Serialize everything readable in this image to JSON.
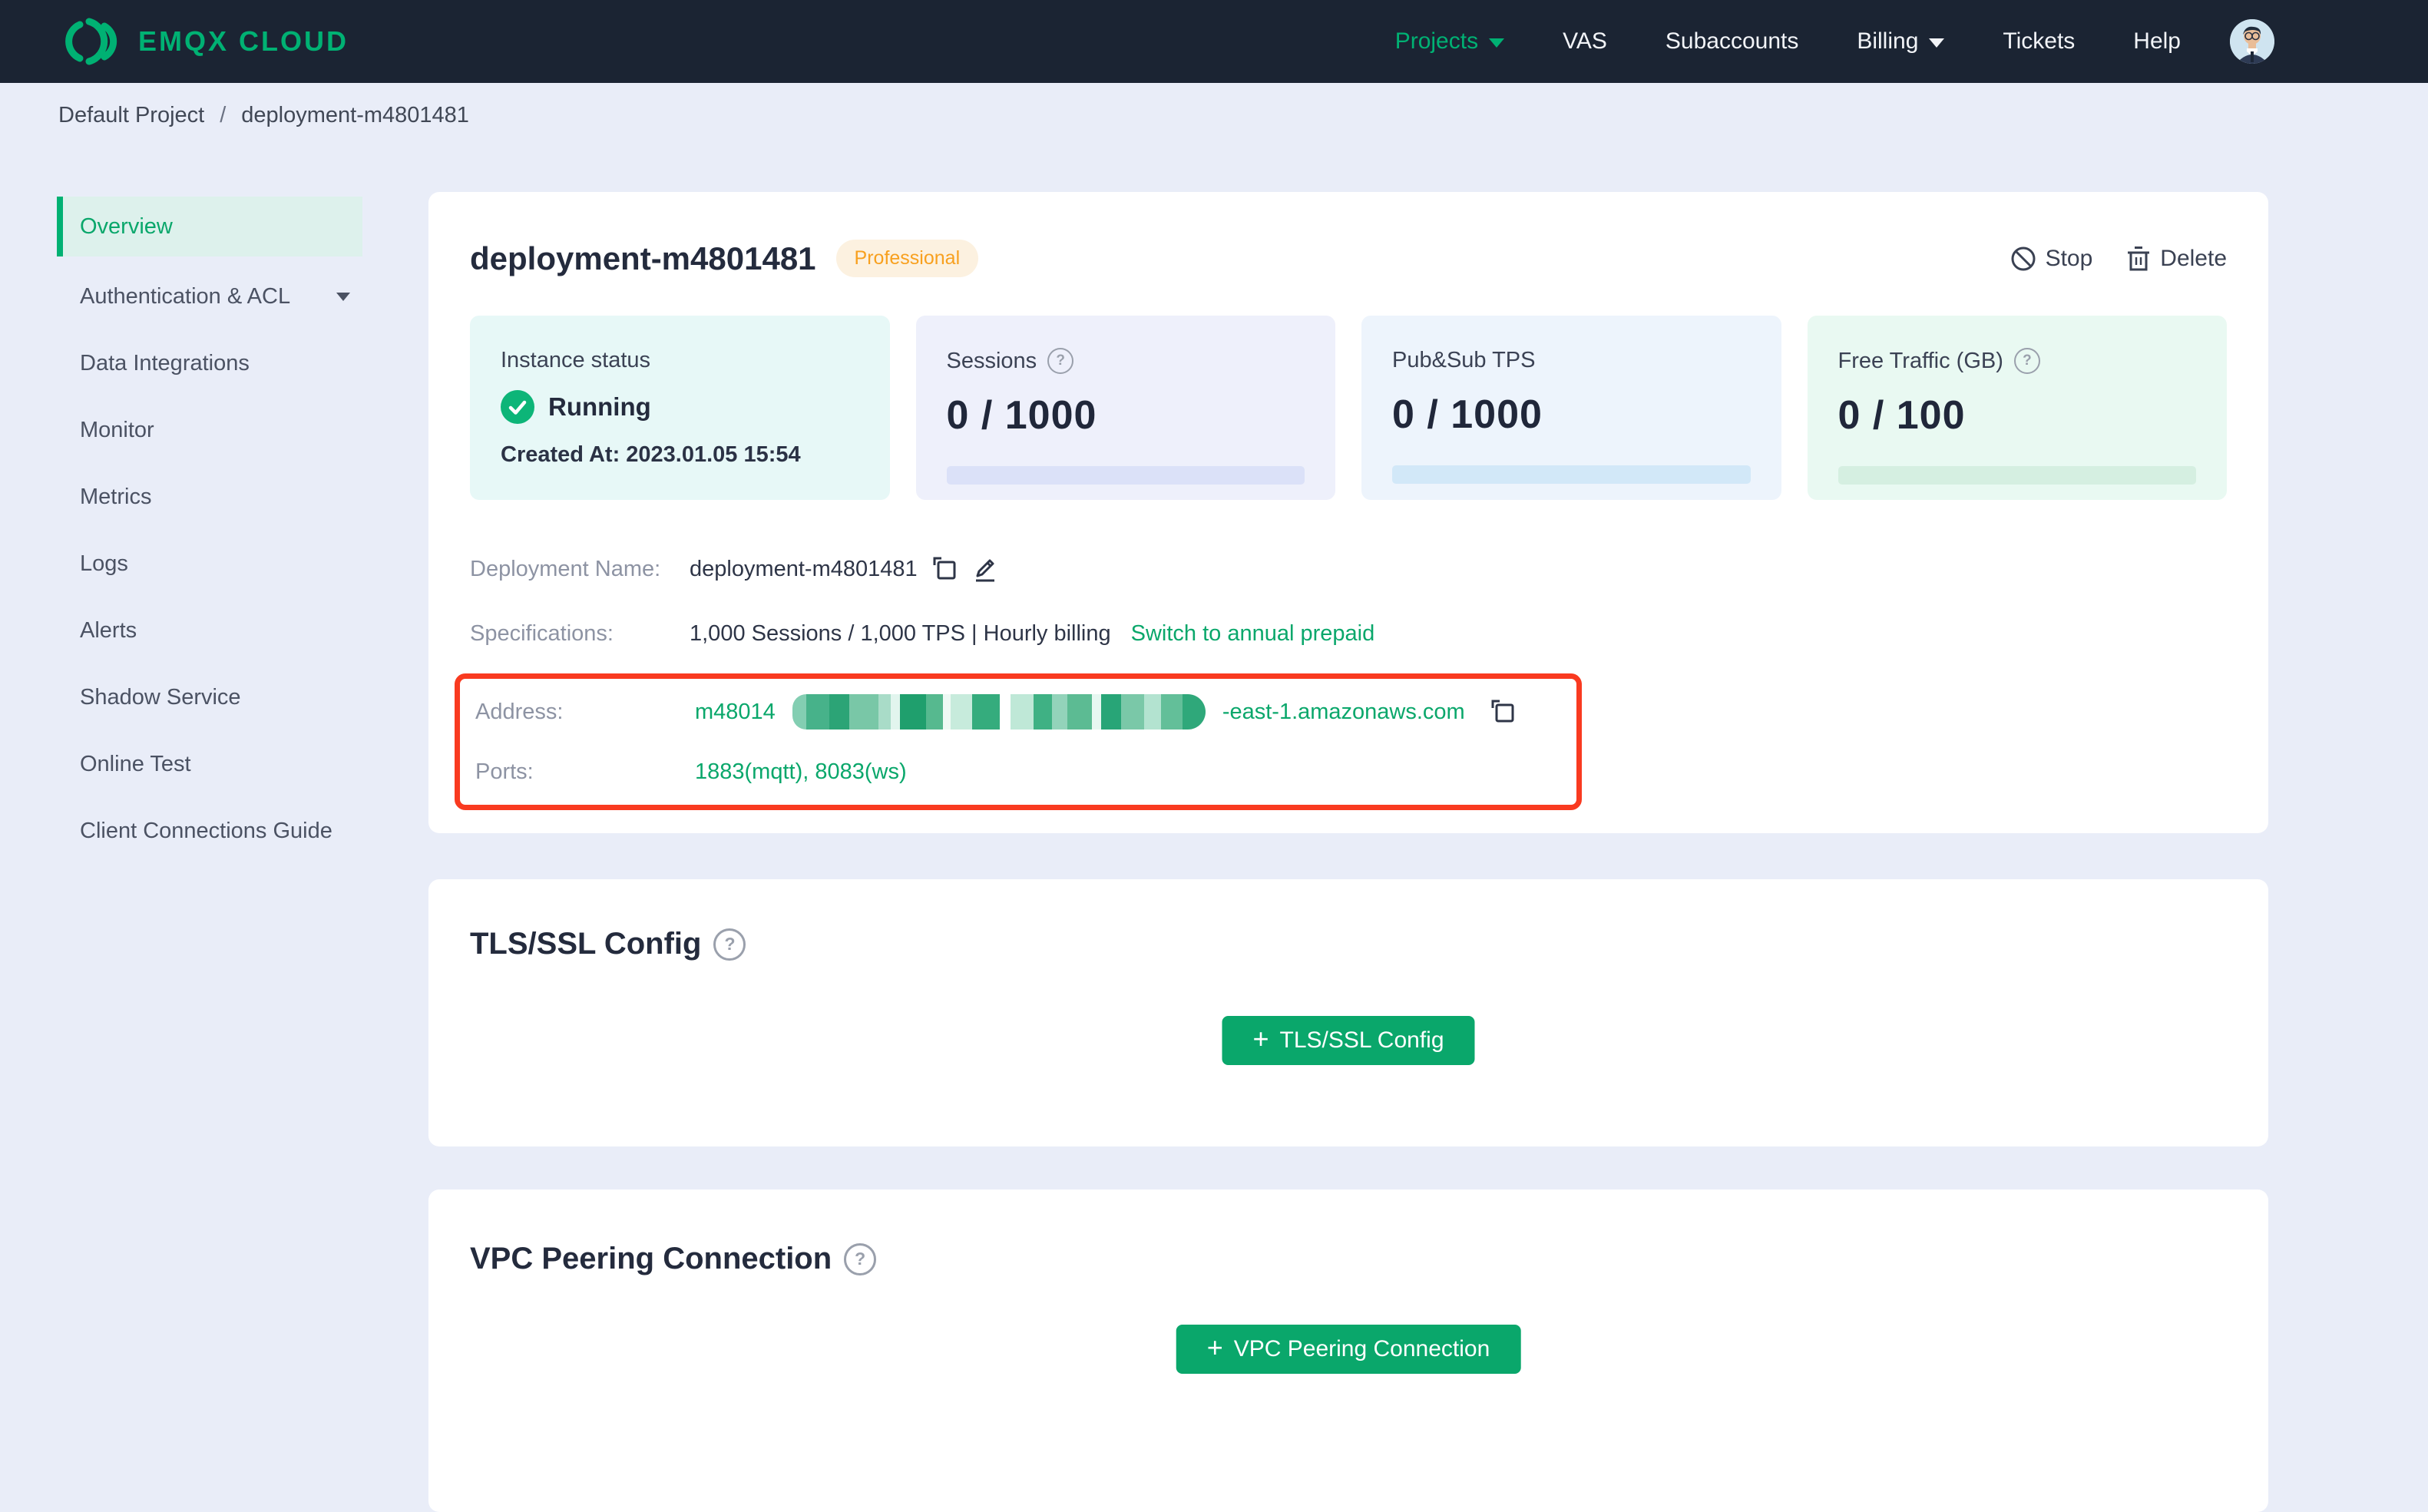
{
  "navbar": {
    "logo_text": "EMQX CLOUD",
    "items": [
      {
        "label": "Projects",
        "active": true,
        "has_dropdown": true
      },
      {
        "label": "VAS"
      },
      {
        "label": "Subaccounts"
      },
      {
        "label": "Billing",
        "has_dropdown": true
      },
      {
        "label": "Tickets"
      },
      {
        "label": "Help"
      }
    ]
  },
  "breadcrumb": {
    "project": "Default Project",
    "separator": "/",
    "current": "deployment-m4801481"
  },
  "sidebar": {
    "items": [
      {
        "label": "Overview",
        "active": true
      },
      {
        "label": "Authentication & ACL",
        "has_dropdown": true
      },
      {
        "label": "Data Integrations"
      },
      {
        "label": "Monitor"
      },
      {
        "label": "Metrics"
      },
      {
        "label": "Logs"
      },
      {
        "label": "Alerts"
      },
      {
        "label": "Shadow Service"
      },
      {
        "label": "Online Test"
      },
      {
        "label": "Client Connections Guide"
      }
    ]
  },
  "deployment": {
    "title": "deployment-m4801481",
    "badge": "Professional",
    "actions": {
      "stop_label": "Stop",
      "delete_label": "Delete"
    },
    "stats": [
      {
        "label": "Instance status",
        "status_label": "Running",
        "created_at": "Created At: 2023.01.05 15:54"
      },
      {
        "label": "Sessions",
        "value": "0 / 1000",
        "has_help": true
      },
      {
        "label": "Pub&Sub TPS",
        "value": "0 / 1000"
      },
      {
        "label": "Free Traffic (GB)",
        "value": "0 / 100",
        "has_help": true
      }
    ],
    "details": {
      "deployment_name_label": "Deployment Name:",
      "deployment_name": "deployment-m4801481",
      "specifications_label": "Specifications:",
      "specifications": "1,000 Sessions / 1,000 TPS | Hourly billing",
      "switch_link": "Switch to annual prepaid",
      "address_label": "Address:",
      "address_prefix": "m48014",
      "address_suffix": "-east-1.amazonaws.com",
      "ports_label": "Ports:",
      "ports": "1883(mqtt), 8083(ws)"
    }
  },
  "sections": [
    {
      "title": "TLS/SSL Config",
      "button_label": "TLS/SSL Config"
    },
    {
      "title": "VPC Peering Connection",
      "button_label": "VPC Peering Connection"
    }
  ],
  "icons": {
    "question": "?"
  },
  "colors": {
    "navbar_bg": "#1b2433",
    "brand_green": "#00b173",
    "link_green": "#0aa76b",
    "page_bg": "#e9edf8",
    "badge_bg": "#fcf1e0",
    "badge_text": "#f8a01e",
    "highlight_red": "#f93a20",
    "running_green": "#0db578",
    "stat_bgs": [
      "#e7f8f7",
      "#eef0fb",
      "#edf4fc",
      "#e9f9f2"
    ]
  },
  "redaction": {
    "blocks": [
      {
        "w": 18,
        "c": "#83ceb2"
      },
      {
        "w": 30,
        "c": "#47b28a"
      },
      {
        "w": 26,
        "c": "#2ca476"
      },
      {
        "w": 38,
        "c": "#79c7a7"
      },
      {
        "w": 16,
        "c": "#a9dcc8"
      },
      {
        "w": 12,
        "c": "#e2f5ee"
      },
      {
        "w": 34,
        "c": "#1f9f6d"
      },
      {
        "w": 22,
        "c": "#56b98f"
      },
      {
        "w": 10,
        "c": "#eef9f4"
      },
      {
        "w": 28,
        "c": "#c7ebdc"
      },
      {
        "w": 36,
        "c": "#35ac7d"
      },
      {
        "w": 14,
        "c": "#ffffff"
      },
      {
        "w": 30,
        "c": "#bfe8d7"
      },
      {
        "w": 24,
        "c": "#3fb184"
      },
      {
        "w": 20,
        "c": "#93d3ba"
      },
      {
        "w": 32,
        "c": "#5cbb93"
      },
      {
        "w": 12,
        "c": "#e7f7f1"
      },
      {
        "w": 26,
        "c": "#28a577"
      },
      {
        "w": 30,
        "c": "#7ac8a8"
      },
      {
        "w": 22,
        "c": "#b3e3d0"
      },
      {
        "w": 28,
        "c": "#63bf99"
      },
      {
        "w": 30,
        "c": "#2fa87a"
      }
    ]
  }
}
